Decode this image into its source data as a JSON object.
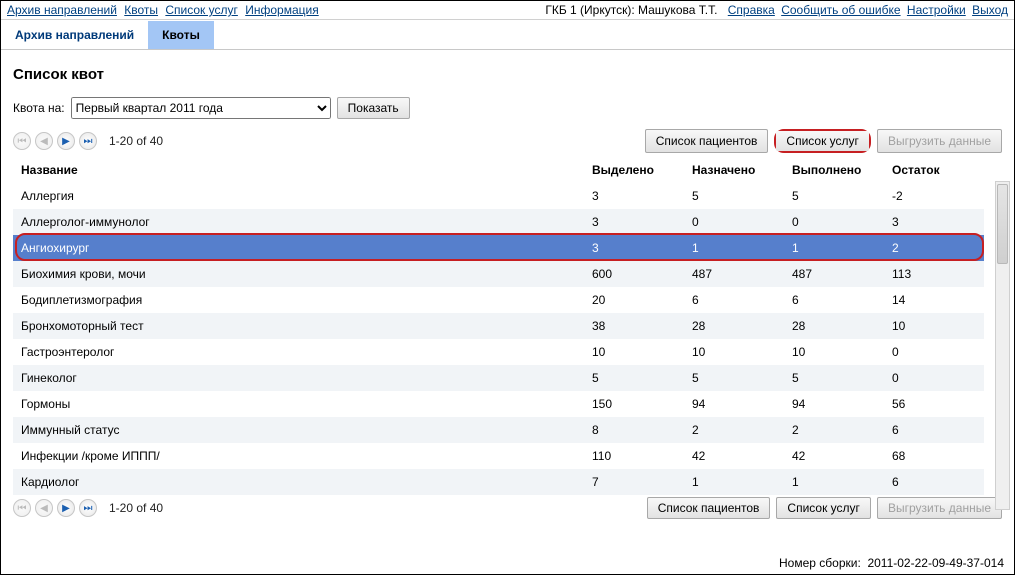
{
  "top_left_links": [
    "Архив направлений",
    "Квоты",
    "Список услуг",
    "Информация"
  ],
  "top_right_plain": "ГКБ 1 (Иркутск): Машукова Т.Т.",
  "top_right_links": [
    "Справка",
    "Сообщить об ошибке",
    "Настройки",
    "Выход"
  ],
  "tabs": [
    {
      "label": "Архив направлений",
      "active": false
    },
    {
      "label": "Квоты",
      "active": true
    }
  ],
  "page_title": "Список квот",
  "filter": {
    "label": "Квота на:",
    "selected_period": "Первый квартал 2011 года",
    "show_button": "Показать"
  },
  "pager_text": "1-20 of 40",
  "action_buttons": {
    "patients": "Список пациентов",
    "services": "Список услуг",
    "export": "Выгрузить данные"
  },
  "columns": [
    "Название",
    "Выделено",
    "Назначено",
    "Выполнено",
    "Остаток"
  ],
  "rows": [
    {
      "name": "Аллергия",
      "allocated": "3",
      "assigned": "5",
      "done": "5",
      "rest": "-2",
      "selected": false
    },
    {
      "name": "Аллерголог-иммунолог",
      "allocated": "3",
      "assigned": "0",
      "done": "0",
      "rest": "3",
      "selected": false
    },
    {
      "name": "Ангиохирург",
      "allocated": "3",
      "assigned": "1",
      "done": "1",
      "rest": "2",
      "selected": true
    },
    {
      "name": "Биохимия крови, мочи",
      "allocated": "600",
      "assigned": "487",
      "done": "487",
      "rest": "113",
      "selected": false
    },
    {
      "name": "Бодиплетизмография",
      "allocated": "20",
      "assigned": "6",
      "done": "6",
      "rest": "14",
      "selected": false
    },
    {
      "name": "Бронхомоторный тест",
      "allocated": "38",
      "assigned": "28",
      "done": "28",
      "rest": "10",
      "selected": false
    },
    {
      "name": "Гастроэнтеролог",
      "allocated": "10",
      "assigned": "10",
      "done": "10",
      "rest": "0",
      "selected": false
    },
    {
      "name": "Гинеколог",
      "allocated": "5",
      "assigned": "5",
      "done": "5",
      "rest": "0",
      "selected": false
    },
    {
      "name": "Гормоны",
      "allocated": "150",
      "assigned": "94",
      "done": "94",
      "rest": "56",
      "selected": false
    },
    {
      "name": "Иммунный статус",
      "allocated": "8",
      "assigned": "2",
      "done": "2",
      "rest": "6",
      "selected": false
    },
    {
      "name": "Инфекции /кроме ИППП/",
      "allocated": "110",
      "assigned": "42",
      "done": "42",
      "rest": "68",
      "selected": false
    },
    {
      "name": "Кардиолог",
      "allocated": "7",
      "assigned": "1",
      "done": "1",
      "rest": "6",
      "selected": false
    }
  ],
  "build_label": "Номер сборки:",
  "build_number": "2011-02-22-09-49-37-014"
}
